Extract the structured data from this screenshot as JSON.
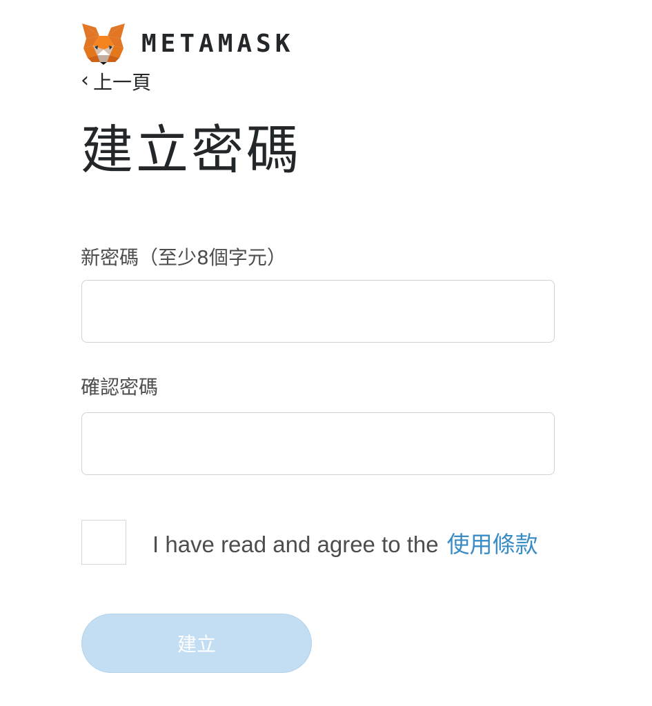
{
  "header": {
    "logo_icon": "metamask-fox-icon",
    "brand": "METAMASK"
  },
  "nav": {
    "back_icon": "chevron-left-icon",
    "back_chevron": "‹",
    "back_label": "上一頁"
  },
  "page": {
    "title": "建立密碼"
  },
  "form": {
    "new_password": {
      "label": "新密碼（至少8個字元）",
      "value": "",
      "placeholder": ""
    },
    "confirm_password": {
      "label": "確認密碼",
      "value": "",
      "placeholder": ""
    },
    "terms": {
      "checked": false,
      "text": "I have read and agree to the",
      "link": "使用條款"
    },
    "submit": {
      "label": "建立",
      "disabled": true
    }
  },
  "colors": {
    "link": "#3a8cc6",
    "button_disabled_bg": "#c3def3",
    "text": "#24272a",
    "fox_orange": "#e2761b"
  }
}
